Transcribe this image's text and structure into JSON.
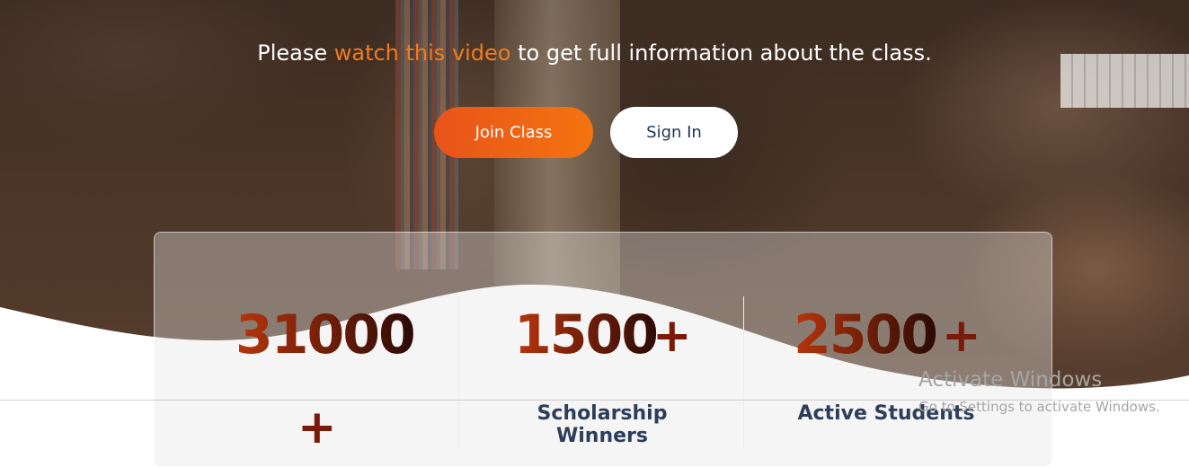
{
  "hero": {
    "subtitle_before": "Please ",
    "subtitle_link": "watch this video",
    "subtitle_after": " to get full information about the class.",
    "accent_color": "#f07d1c"
  },
  "buttons": {
    "join_label": "Join Class",
    "signin_label": "Sign In",
    "join_gradient": [
      "#e8531a",
      "#f4740f"
    ]
  },
  "stats": [
    {
      "number": "31000",
      "suffix": "+",
      "label": ""
    },
    {
      "number": "1500",
      "suffix": "+",
      "label": "Scholarship Winners"
    },
    {
      "number": "2500",
      "suffix": "+",
      "label": "Active Students"
    }
  ],
  "watermark": {
    "title": "Activate Windows",
    "subtitle": "Go to Settings to activate Windows."
  }
}
